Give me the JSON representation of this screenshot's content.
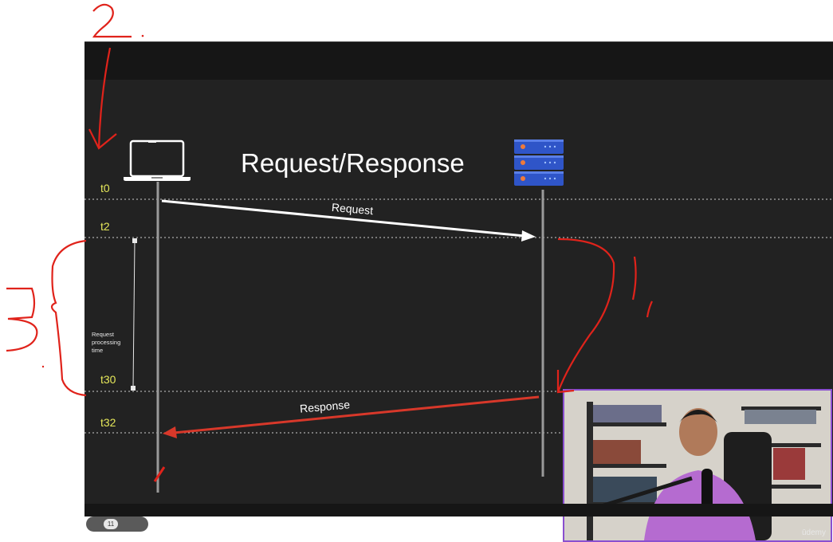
{
  "slide": {
    "title": "Request/Response",
    "time_labels": {
      "t0": "t0",
      "t2": "t2",
      "t30": "t30",
      "t32": "t32"
    },
    "request_label": "Request",
    "response_label": "Response",
    "processing_label": [
      "Request",
      "processing",
      "time"
    ],
    "slide_number": "11"
  },
  "annotations": {
    "a1": "1",
    "a2": "2",
    "a3": "3"
  },
  "webcam": {
    "watermark": "ūdemy"
  },
  "colors": {
    "accent_yellow": "#e6e85a",
    "ink_red": "#e0231b",
    "response_arrow": "#d8382a",
    "webcam_border": "#8a4fd0"
  },
  "icons": [
    "laptop-icon",
    "server-icon"
  ]
}
